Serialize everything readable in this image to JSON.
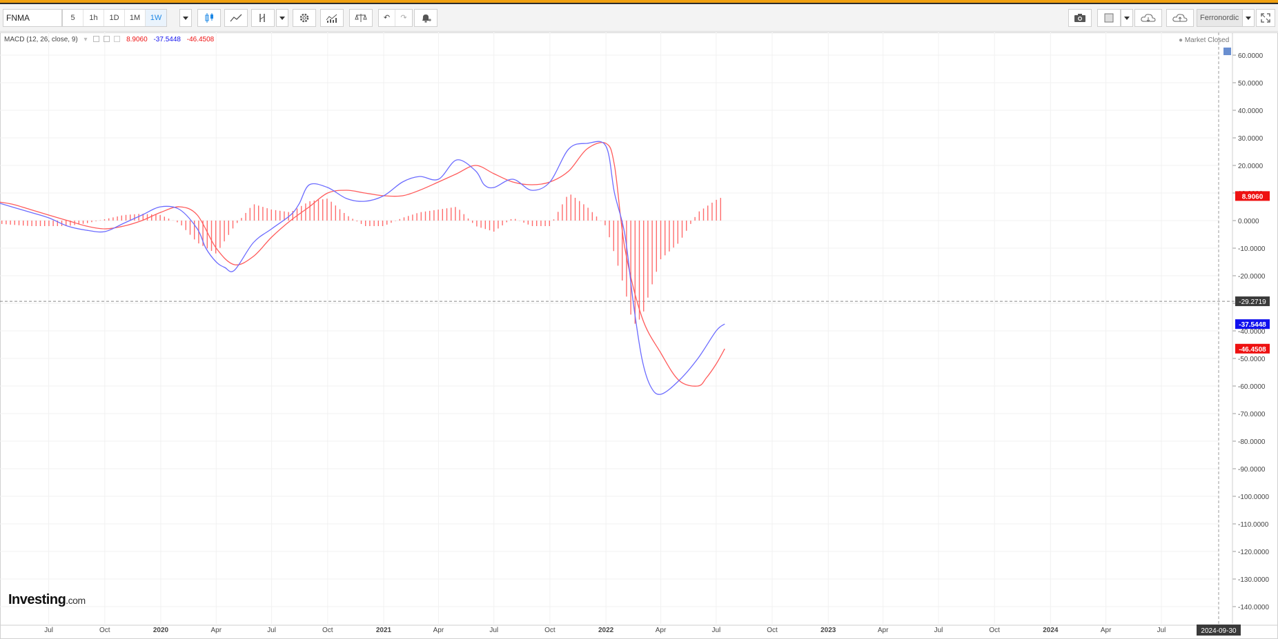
{
  "toolbar": {
    "symbol": "FNMA",
    "intervals": [
      "5",
      "1h",
      "1D",
      "1M",
      "1W"
    ],
    "active_interval": "1W",
    "user": "Ferronordic"
  },
  "legend": {
    "indicator": "MACD (12, 26, close, 9)",
    "histogram_value": "8.9060",
    "macd_value": "-37.5448",
    "signal_value": "-46.4508"
  },
  "status": {
    "market": "Market Closed"
  },
  "logo": {
    "text": "Investing",
    "suffix": ".com"
  },
  "colors": {
    "macd": "#6b6bff",
    "signal": "#ff5a5a",
    "histogram": "#ff6b6b",
    "accent": "#1e88e5",
    "topstripe": "#f0a010"
  },
  "chart_data": {
    "type": "line",
    "title": "MACD (12, 26, close, 9)",
    "ylim": [
      -145,
      65
    ],
    "y_ticks": [
      "60.0000",
      "50.0000",
      "40.0000",
      "30.0000",
      "20.0000",
      "10.0000",
      "0.0000",
      "-10.0000",
      "-20.0000",
      "-30.0000",
      "-40.0000",
      "-50.0000",
      "-60.0000",
      "-70.0000",
      "-80.0000",
      "-90.0000",
      "-100.0000",
      "-110.0000",
      "-120.0000",
      "-130.0000",
      "-140.0000"
    ],
    "x_ticks": [
      "Jul",
      "Oct",
      "2020",
      "Apr",
      "Jul",
      "Oct",
      "2021",
      "Apr",
      "Jul",
      "Oct",
      "2022",
      "Apr",
      "Jul",
      "Oct",
      "2023",
      "Apr",
      "Jul",
      "Oct",
      "2024",
      "Apr",
      "Jul"
    ],
    "x_bold": [
      "2020",
      "2021",
      "2022",
      "2023",
      "2024"
    ],
    "x_end_label": "2024-09-30",
    "crosshair_label": "-29.2719",
    "badges": [
      {
        "label": "8.9060",
        "value": 8.906,
        "color": "#ee1111"
      },
      {
        "label": "-37.5448",
        "value": -37.5448,
        "color": "#1111ee"
      },
      {
        "label": "-46.4508",
        "value": -46.4508,
        "color": "#ee1111"
      }
    ],
    "series": [
      {
        "name": "MACD",
        "color": "#6b6bff",
        "x": [
          "2019-04-01",
          "2019-05-01",
          "2019-06-01",
          "2019-07-01",
          "2019-08-01",
          "2019-09-01",
          "2019-10-01",
          "2019-11-01",
          "2019-12-01",
          "2020-01-01",
          "2020-02-01",
          "2020-03-01",
          "2020-03-15",
          "2020-04-01",
          "2020-04-15",
          "2020-05-01",
          "2020-06-01",
          "2020-07-01",
          "2020-08-01",
          "2020-08-15",
          "2020-09-01",
          "2020-10-01",
          "2020-11-01",
          "2020-12-01",
          "2021-01-01",
          "2021-02-01",
          "2021-03-01",
          "2021-04-01",
          "2021-05-01",
          "2021-06-01",
          "2021-06-15",
          "2021-07-01",
          "2021-08-01",
          "2021-09-01",
          "2021-10-01",
          "2021-11-01",
          "2021-12-01",
          "2022-01-01",
          "2022-01-15",
          "2022-02-01",
          "2022-02-15",
          "2022-03-01",
          "2022-03-15",
          "2022-04-01",
          "2022-05-01",
          "2022-06-01",
          "2022-07-01",
          "2022-07-15"
        ],
        "values": [
          7,
          5,
          3,
          1,
          -2,
          -3.5,
          -4,
          -1,
          2,
          5,
          4,
          -3,
          -10,
          -15,
          -17,
          -18,
          -8,
          -3,
          2,
          6,
          13,
          12,
          8,
          7,
          9,
          14,
          16,
          15,
          22,
          18,
          13,
          12,
          15,
          11,
          14,
          26,
          28,
          27,
          10,
          -5,
          -30,
          -50,
          -60,
          -63,
          -58,
          -50,
          -40,
          -37.5
        ]
      },
      {
        "name": "Signal",
        "color": "#ff5a5a",
        "x": [
          "2019-04-01",
          "2019-05-01",
          "2019-06-01",
          "2019-07-01",
          "2019-08-01",
          "2019-09-01",
          "2019-10-01",
          "2019-11-01",
          "2019-12-01",
          "2020-01-01",
          "2020-02-01",
          "2020-03-01",
          "2020-04-01",
          "2020-05-01",
          "2020-06-01",
          "2020-07-01",
          "2020-08-01",
          "2020-09-01",
          "2020-10-01",
          "2020-11-01",
          "2020-12-01",
          "2021-01-01",
          "2021-02-01",
          "2021-03-01",
          "2021-04-01",
          "2021-05-01",
          "2021-06-01",
          "2021-07-01",
          "2021-08-01",
          "2021-09-01",
          "2021-10-01",
          "2021-11-01",
          "2021-12-01",
          "2022-01-01",
          "2022-01-15",
          "2022-02-01",
          "2022-03-01",
          "2022-04-01",
          "2022-05-01",
          "2022-06-01",
          "2022-06-15",
          "2022-07-01",
          "2022-07-15"
        ],
        "values": [
          7,
          6,
          4,
          2,
          0,
          -2,
          -3,
          -2,
          0,
          3,
          5,
          2,
          -10,
          -16,
          -13,
          -6,
          0,
          5,
          10,
          11,
          10,
          9,
          9,
          11,
          14,
          17,
          20,
          17,
          14,
          13,
          14,
          18,
          26,
          28,
          20,
          -10,
          -35,
          -48,
          -58,
          -60,
          -57,
          -52,
          -46.5
        ]
      },
      {
        "name": "Histogram",
        "color": "#ff6b6b",
        "x": [
          "2019-04-01",
          "2019-05-01",
          "2019-06-01",
          "2019-07-01",
          "2019-08-01",
          "2019-09-01",
          "2019-10-01",
          "2019-11-01",
          "2019-12-01",
          "2020-01-01",
          "2020-02-01",
          "2020-03-01",
          "2020-04-01",
          "2020-05-01",
          "2020-06-01",
          "2020-07-01",
          "2020-08-01",
          "2020-09-01",
          "2020-10-01",
          "2020-11-01",
          "2020-12-01",
          "2021-01-01",
          "2021-02-01",
          "2021-03-01",
          "2021-04-01",
          "2021-05-01",
          "2021-06-01",
          "2021-07-01",
          "2021-08-01",
          "2021-09-01",
          "2021-10-01",
          "2021-11-01",
          "2021-12-01",
          "2022-01-01",
          "2022-01-15",
          "2022-02-01",
          "2022-02-15",
          "2022-03-01",
          "2022-03-15",
          "2022-04-01",
          "2022-05-01",
          "2022-06-01",
          "2022-07-01",
          "2022-07-15"
        ],
        "values": [
          -1,
          -1.5,
          -2,
          -2,
          -2,
          -1,
          0.5,
          2,
          2.5,
          2,
          -1,
          -8,
          -12,
          -2,
          6,
          4,
          3,
          7,
          8,
          2,
          -2,
          -2,
          1,
          3,
          4,
          5,
          -2,
          -4,
          1,
          -2,
          -2,
          10,
          5,
          -2,
          -12,
          -25,
          -38,
          -35,
          -25,
          -14,
          -8,
          3,
          7.5,
          8.9
        ]
      }
    ]
  }
}
